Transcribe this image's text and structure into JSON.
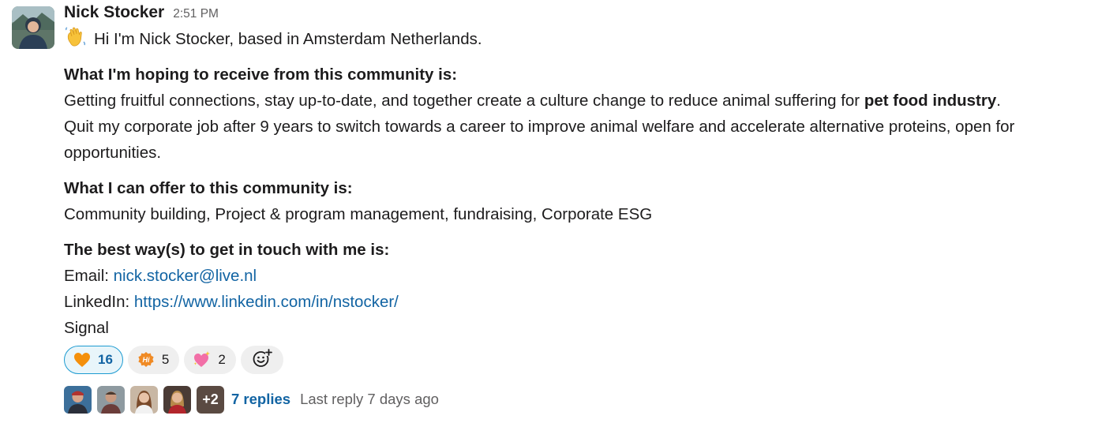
{
  "message": {
    "sender": "Nick Stocker",
    "time": "2:51 PM",
    "greeting": "Hi I'm Nick Stocker, based in Amsterdam Netherlands.",
    "receive_heading": "What I'm hoping to receive from this community is:",
    "receive_text_1": "Getting fruitful connections, stay up-to-date, and together create a culture change to reduce animal suffering for ",
    "receive_text_bold": "pet food industry",
    "receive_text_2": ".",
    "receive_text_3": "Quit my corporate job after 9 years to switch towards a career to improve animal welfare and accelerate alternative proteins, open for opportunities.",
    "offer_heading": "What I can offer to this community is:",
    "offer_text": "Community building, Project & program management, fundraising, Corporate ESG",
    "contact_heading": "The best way(s) to get in touch with me is:",
    "email_label": "Email: ",
    "email": "nick.stocker@live.nl",
    "linkedin_label": "LinkedIn: ",
    "linkedin": "https://www.linkedin.com/in/nstocker/",
    "signal": "Signal"
  },
  "reactions": [
    {
      "emoji": "orange-heart",
      "count": "16",
      "active": true
    },
    {
      "emoji": "hi-bubble",
      "count": "5",
      "active": false
    },
    {
      "emoji": "sparkling-heart",
      "count": "2",
      "active": false
    }
  ],
  "add_reaction_icon": "add-reaction-icon",
  "thread": {
    "more_count": "+2",
    "replies": "7 replies",
    "last_reply": "Last reply 7 days ago"
  },
  "colors": {
    "link": "#1264a3",
    "active_reaction_border": "#1d9bd1",
    "active_reaction_bg": "#e8f5fa",
    "reaction_bg": "#efefef",
    "muted_text": "#616061"
  }
}
